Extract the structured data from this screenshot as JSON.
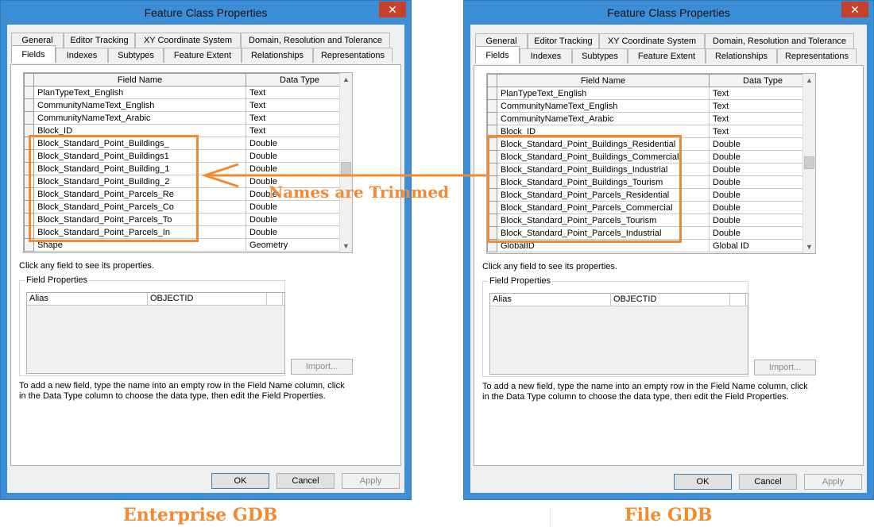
{
  "dialog_title": "Feature Class Properties",
  "close_glyph": "✕",
  "tabs_row1": [
    "General",
    "Editor Tracking",
    "XY Coordinate System",
    "Domain, Resolution and Tolerance"
  ],
  "tabs_row2": [
    "Fields",
    "Indexes",
    "Subtypes",
    "Feature Extent",
    "Relationships",
    "Representations"
  ],
  "grid_headers": {
    "field_name": "Field Name",
    "data_type": "Data Type"
  },
  "scroll_up": "▲",
  "scroll_down": "▼",
  "hint": "Click any field to see its properties.",
  "field_properties": {
    "legend": "Field Properties",
    "alias_label": "Alias",
    "alias_value": "OBJECTID"
  },
  "import_label": "Import...",
  "add_help": "To add a new field, type the name into an empty row in the Field Name column, click in the Data Type column to choose the data type, then edit the Field Properties.",
  "buttons": {
    "ok": "OK",
    "cancel": "Cancel",
    "apply": "Apply"
  },
  "left_dialog": {
    "rows": [
      [
        "PlanTypeText_English",
        "Text"
      ],
      [
        "CommunityNameText_English",
        "Text"
      ],
      [
        "CommunityNameText_Arabic",
        "Text"
      ],
      [
        "Block_ID",
        "Text"
      ],
      [
        "Block_Standard_Point_Buildings_",
        "Double"
      ],
      [
        "Block_Standard_Point_Buildings1",
        "Double"
      ],
      [
        "Block_Standard_Point_Building_1",
        "Double"
      ],
      [
        "Block_Standard_Point_Building_2",
        "Double"
      ],
      [
        "Block_Standard_Point_Parcels_Re",
        "Double"
      ],
      [
        "Block_Standard_Point_Parcels_Co",
        "Double"
      ],
      [
        "Block_Standard_Point_Parcels_To",
        "Double"
      ],
      [
        "Block_Standard_Point_Parcels_In",
        "Double"
      ],
      [
        "Shape",
        "Geometry"
      ]
    ]
  },
  "right_dialog": {
    "rows": [
      [
        "PlanTypeText_English",
        "Text"
      ],
      [
        "CommunityNameText_English",
        "Text"
      ],
      [
        "CommunityNameText_Arabic",
        "Text"
      ],
      [
        "Block_ID",
        "Text"
      ],
      [
        "Block_Standard_Point_Buildings_Residential",
        "Double"
      ],
      [
        "Block_Standard_Point_Buildings_Commercial",
        "Double"
      ],
      [
        "Block_Standard_Point_Buildings_Industrial",
        "Double"
      ],
      [
        "Block_Standard_Point_Buildings_Tourism",
        "Double"
      ],
      [
        "Block_Standard_Point_Parcels_Residential",
        "Double"
      ],
      [
        "Block_Standard_Point_Parcels_Commercial",
        "Double"
      ],
      [
        "Block_Standard_Point_Parcels_Tourism",
        "Double"
      ],
      [
        "Block_Standard_Point_Parcels_Industrial",
        "Double"
      ],
      [
        "GlobalID",
        "Global ID"
      ]
    ]
  },
  "annotation": "Names are Trimmed",
  "caption_left": "Enterprise GDB",
  "caption_right": "File GDB",
  "colors": {
    "annotation_orange": "#f28a30",
    "window_border": "#3c8fd6",
    "close_red": "#c7402e"
  }
}
